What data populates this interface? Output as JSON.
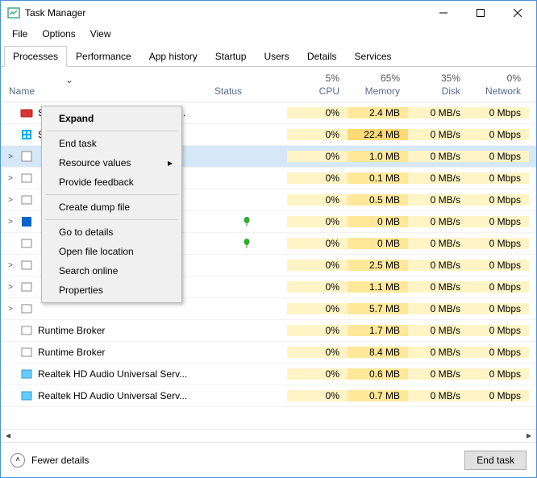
{
  "window": {
    "title": "Task Manager"
  },
  "menubar": {
    "file": "File",
    "options": "Options",
    "view": "View"
  },
  "tabs": {
    "processes": "Processes",
    "performance": "Performance",
    "apphistory": "App history",
    "startup": "Startup",
    "users": "Users",
    "details": "Details",
    "services": "Services"
  },
  "columns": {
    "name": "Name",
    "status": "Status",
    "cpu": {
      "pct": "5%",
      "label": "CPU"
    },
    "memory": {
      "pct": "65%",
      "label": "Memory"
    },
    "disk": {
      "pct": "35%",
      "label": "Disk"
    },
    "network": {
      "pct": "0%",
      "label": "Network"
    }
  },
  "rows": [
    {
      "exp": "",
      "name": "Synaptics TouchPad 64-bit Enha...",
      "cpu": "0%",
      "mem": "2.4 MB",
      "disk": "0 MB/s",
      "net": "0 Mbps",
      "leaf": false,
      "membg": "mem-bg"
    },
    {
      "exp": "",
      "name": "Start",
      "cpu": "0%",
      "mem": "22.4 MB",
      "disk": "0 MB/s",
      "net": "0 Mbps",
      "leaf": false,
      "membg": "mem-bg2"
    },
    {
      "exp": ">",
      "name": "",
      "cpu": "0%",
      "mem": "1.0 MB",
      "disk": "0 MB/s",
      "net": "0 Mbps",
      "leaf": false,
      "selected": true,
      "membg": "mem-bg"
    },
    {
      "exp": ">",
      "name": "",
      "cpu": "0%",
      "mem": "0.1 MB",
      "disk": "0 MB/s",
      "net": "0 Mbps",
      "leaf": false,
      "membg": "mem-bg"
    },
    {
      "exp": ">",
      "name": "",
      "cpu": "0%",
      "mem": "0.5 MB",
      "disk": "0 MB/s",
      "net": "0 Mbps",
      "leaf": false,
      "membg": "mem-bg"
    },
    {
      "exp": ">",
      "name": "",
      "cpu": "0%",
      "mem": "0 MB",
      "disk": "0 MB/s",
      "net": "0 Mbps",
      "leaf": true,
      "membg": "mem-bg"
    },
    {
      "exp": "",
      "name": "",
      "cpu": "0%",
      "mem": "0 MB",
      "disk": "0 MB/s",
      "net": "0 Mbps",
      "leaf": true,
      "membg": "mem-bg"
    },
    {
      "exp": ">",
      "name": "",
      "cpu": "0%",
      "mem": "2.5 MB",
      "disk": "0 MB/s",
      "net": "0 Mbps",
      "leaf": false,
      "membg": "mem-bg"
    },
    {
      "exp": ">",
      "name": "",
      "cpu": "0%",
      "mem": "1.1 MB",
      "disk": "0 MB/s",
      "net": "0 Mbps",
      "leaf": false,
      "membg": "mem-bg"
    },
    {
      "exp": ">",
      "name": "",
      "cpu": "0%",
      "mem": "5.7 MB",
      "disk": "0 MB/s",
      "net": "0 Mbps",
      "leaf": false,
      "membg": "mem-bg"
    },
    {
      "exp": "",
      "name": "Runtime Broker",
      "cpu": "0%",
      "mem": "1.7 MB",
      "disk": "0 MB/s",
      "net": "0 Mbps",
      "leaf": false,
      "membg": "mem-bg"
    },
    {
      "exp": "",
      "name": "Runtime Broker",
      "cpu": "0%",
      "mem": "8.4 MB",
      "disk": "0 MB/s",
      "net": "0 Mbps",
      "leaf": false,
      "membg": "mem-bg"
    },
    {
      "exp": "",
      "name": "Realtek HD Audio Universal Serv...",
      "cpu": "0%",
      "mem": "0.6 MB",
      "disk": "0 MB/s",
      "net": "0 Mbps",
      "leaf": false,
      "membg": "mem-bg"
    },
    {
      "exp": "",
      "name": "Realtek HD Audio Universal Serv...",
      "cpu": "0%",
      "mem": "0.7 MB",
      "disk": "0 MB/s",
      "net": "0 Mbps",
      "leaf": false,
      "membg": "mem-bg"
    }
  ],
  "context_menu": {
    "expand": "Expand",
    "end_task": "End task",
    "resource_values": "Resource values",
    "provide_feedback": "Provide feedback",
    "create_dump": "Create dump file",
    "go_to_details": "Go to details",
    "open_file_location": "Open file location",
    "search_online": "Search online",
    "properties": "Properties"
  },
  "footer": {
    "fewer_details": "Fewer details",
    "end_task": "End task"
  }
}
